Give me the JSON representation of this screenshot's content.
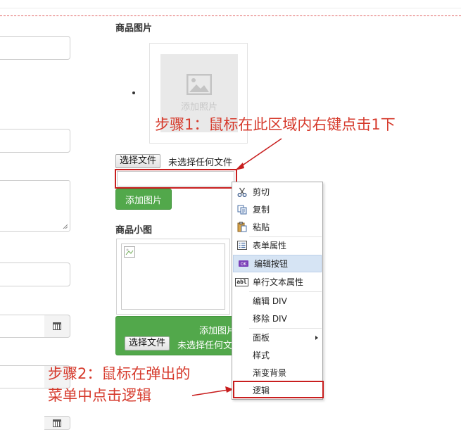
{
  "section_titles": {
    "product_images": "商品图片",
    "product_thumbnail": "商品小图"
  },
  "placeholder_text": "添加照片",
  "file_input": {
    "button": "选择文件",
    "status": "未选择任何文件"
  },
  "add_image_button": "添加图片",
  "thumb_panel": {
    "text": "添加图片",
    "button": "选择文件",
    "status": "未选择任何文"
  },
  "annotations": {
    "step1": "步骤1：鼠标在此区域内右键点击1下",
    "step2_line1": "步骤2：鼠标在弹出的",
    "step2_line2": "菜单中点击逻辑"
  },
  "context_menu": {
    "items": [
      {
        "label": "剪切",
        "icon": "scissors-icon"
      },
      {
        "label": "复制",
        "icon": "copy-icon"
      },
      {
        "label": "粘贴",
        "icon": "paste-icon"
      },
      {
        "label": "表单属性",
        "icon": "form-properties-icon"
      },
      {
        "label": "编辑按钮",
        "icon": "ok-button-icon",
        "highlighted": true
      },
      {
        "label": "单行文本属性",
        "icon": "text-field-icon",
        "icon_text": "abl"
      },
      {
        "label": "编辑 DIV",
        "icon": ""
      },
      {
        "label": "移除 DIV",
        "icon": ""
      },
      {
        "label": "面板",
        "icon": "",
        "submenu": true
      },
      {
        "label": "样式",
        "icon": ""
      },
      {
        "label": "渐变背景",
        "icon": ""
      },
      {
        "label": "逻辑",
        "icon": "",
        "boxed": true
      }
    ]
  },
  "colors": {
    "annotation_red": "#d63a2c",
    "green": "#52a84b",
    "highlight": "#d6e4f4"
  }
}
